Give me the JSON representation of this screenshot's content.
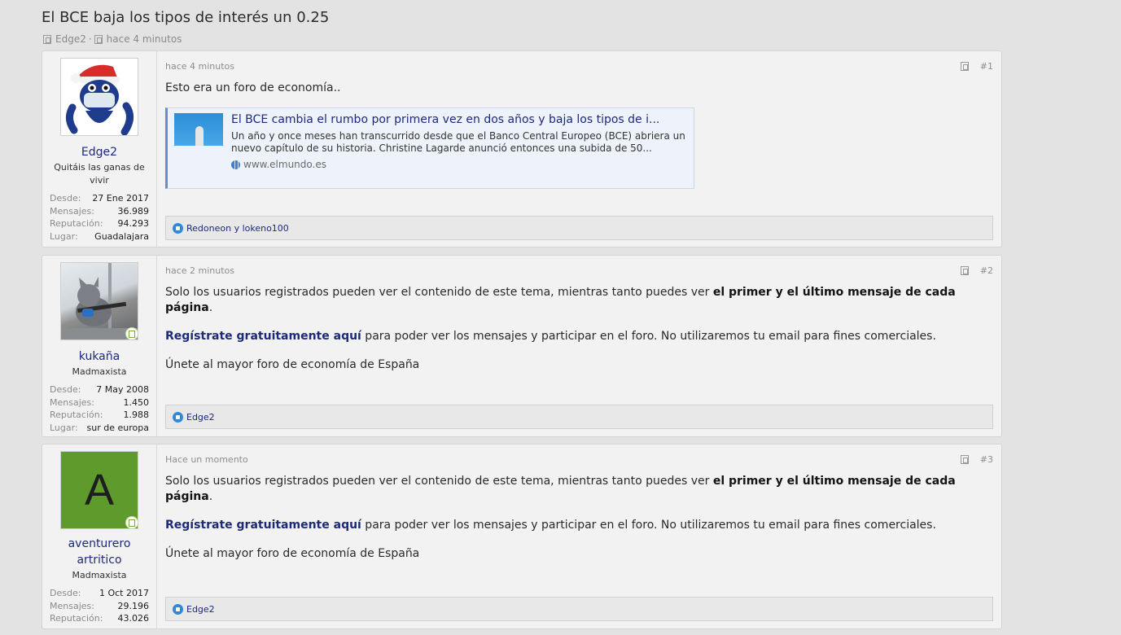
{
  "thread": {
    "title": "El BCE baja los tipos de interés un 0.25",
    "author": "Edge2",
    "separator": "·",
    "time": "hace 4 minutos"
  },
  "posts": [
    {
      "avatar_type": "santa-character",
      "username": "Edge2",
      "usertitle": "Quitáis las ganas de vivir",
      "stats": [
        {
          "label": "Desde:",
          "value": "27 Ene 2017"
        },
        {
          "label": "Mensajes:",
          "value": "36.989"
        },
        {
          "label": "Reputación:",
          "value": "94.293"
        },
        {
          "label": "Lugar:",
          "value": "Guadalajara"
        }
      ],
      "time": "hace 4 minutos",
      "number": "#1",
      "body": "Esto era un foro de economía..",
      "preview": {
        "title": "El BCE cambia el rumbo por primera vez en dos años y baja los tipos de i...",
        "description": "Un año y once meses han transcurrido desde que el Banco Central Europeo (BCE) abriera un nuevo capítulo de su historia. Christine Lagarde anunció entonces una subida de 50...",
        "site": "www.elmundo.es"
      },
      "likes": "Redoneon y lokeno100"
    },
    {
      "avatar_type": "cat-photo",
      "username": "kukaña",
      "usertitle": "Madmaxista",
      "stats": [
        {
          "label": "Desde:",
          "value": "7 May 2008"
        },
        {
          "label": "Mensajes:",
          "value": "1.450"
        },
        {
          "label": "Reputación:",
          "value": "1.988"
        },
        {
          "label": "Lugar:",
          "value": "sur de europa"
        }
      ],
      "time": "hace 2 minutos",
      "number": "#2",
      "msg_pre": "Solo los usuarios registrados pueden ver el contenido de este tema, mientras tanto puedes ver ",
      "msg_bold": "el primer y el último mensaje de cada página",
      "msg_end": ".",
      "reg_link": "Regístrate gratuitamente aquí",
      "reg_rest": " para poder ver los mensajes y participar en el foro. No utilizaremos tu email para fines comerciales.",
      "join": "Únete al mayor foro de economía de España",
      "likes": "Edge2"
    },
    {
      "avatar_type": "letter",
      "avatar_letter": "A",
      "username": "aventurero artritico",
      "usertitle": "Madmaxista",
      "stats": [
        {
          "label": "Desde:",
          "value": "1 Oct 2017"
        },
        {
          "label": "Mensajes:",
          "value": "29.196"
        },
        {
          "label": "Reputación:",
          "value": "43.026"
        }
      ],
      "time": "Hace un momento",
      "number": "#3",
      "msg_pre": "Solo los usuarios registrados pueden ver el contenido de este tema, mientras tanto puedes ver ",
      "msg_bold": "el primer y el último mensaje de cada página",
      "msg_end": ".",
      "reg_link": "Regístrate gratuitamente aquí",
      "reg_rest": " para poder ver los mensajes y participar en el foro. No utilizaremos tu email para fines comerciales.",
      "join": "Únete al mayor foro de economía de España",
      "likes": "Edge2"
    }
  ],
  "colors": {
    "link": "#1c2a7a",
    "avatar_green": "#5f9a2d",
    "like_blue": "#2f88d8"
  }
}
